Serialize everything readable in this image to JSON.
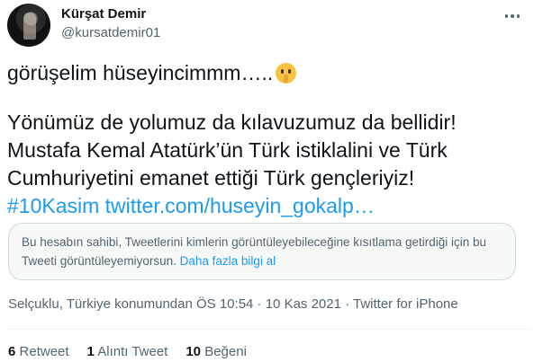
{
  "user": {
    "name": "Kürşat Demir",
    "handle": "@kursatdemir01"
  },
  "tweet": {
    "line1": "görüşelim hüseyincimmm…..",
    "emoji": "shushing-face-emoji",
    "line2": "Yönümüz de yolumuz da kılavuzumuz da bellidir!",
    "line3": "Mustafa Kemal Atatürk’ün Türk istiklalini ve Türk",
    "line4": "Cumhuriyetini emanet ettiği Türk gençleriyiz!",
    "hashtag": "#10Kasim",
    "url": "twitter.com/huseyin_gokalp…"
  },
  "notice": {
    "text": "Bu hesabın sahibi, Tweetlerini kimlerin görüntüleyebileceğine kısıtlama getirdiği için bu Tweeti görüntüleyemiyorsun.",
    "link": "Daha fazla bilgi al"
  },
  "meta": {
    "text": "Selçuklu, Türkiye konumundan ÖS 10:54 · 10 Kas 2021 · Twitter for iPhone"
  },
  "stats": {
    "retweets_count": "6",
    "retweets_label": "Retweet",
    "quotes_count": "1",
    "quotes_label": "Alıntı Tweet",
    "likes_count": "10",
    "likes_label": "Beğeni"
  },
  "colors": {
    "accent": "#1d9bf0",
    "text": "#0f1419",
    "secondary": "#536471"
  }
}
